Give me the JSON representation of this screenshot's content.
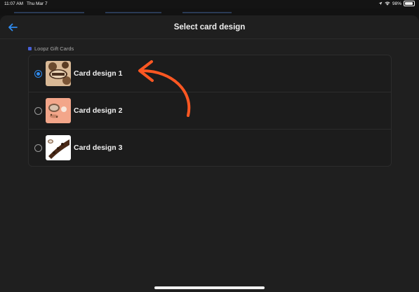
{
  "status_bar": {
    "time": "11:07 AM",
    "date": "Thu Mar 7",
    "battery": "98%",
    "icons": [
      "location-icon",
      "wifi-icon",
      "battery-icon"
    ]
  },
  "header": {
    "title": "Select card design",
    "back_icon": "arrow-left-icon"
  },
  "section": {
    "label": "Loopz Gift Cards"
  },
  "cards": [
    {
      "label": "Card design 1",
      "selected": true
    },
    {
      "label": "Card design 2",
      "selected": false
    },
    {
      "label": "Card design 3",
      "selected": false
    }
  ],
  "colors": {
    "accent": "#2f8cf0",
    "annotation_arrow": "#ff5722",
    "background": "#1f1f1f"
  }
}
